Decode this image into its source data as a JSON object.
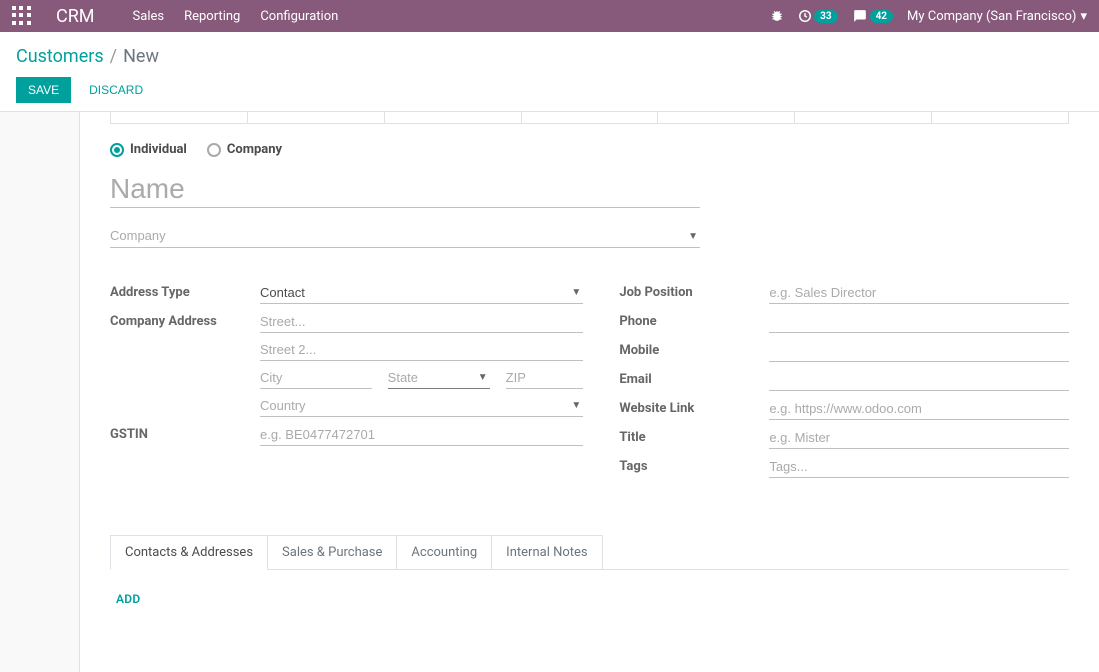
{
  "nav": {
    "brand": "CRM",
    "links": [
      "Sales",
      "Reporting",
      "Configuration"
    ],
    "badge1": "33",
    "badge2": "42",
    "company": "My Company (San Francisco)"
  },
  "breadcrumb": {
    "parent": "Customers",
    "current": "New"
  },
  "buttons": {
    "save": "Save",
    "discard": "Discard"
  },
  "radios": {
    "individual": "Individual",
    "company": "Company"
  },
  "name_placeholder": "Name",
  "company_placeholder": "Company",
  "left": {
    "address_type": {
      "label": "Address Type",
      "value": "Contact"
    },
    "company_address": {
      "label": "Company Address"
    },
    "street_ph": "Street...",
    "street2_ph": "Street 2...",
    "city_ph": "City",
    "state_ph": "State",
    "zip_ph": "ZIP",
    "country_ph": "Country",
    "gstin": {
      "label": "GSTIN",
      "placeholder": "e.g. BE0477472701"
    }
  },
  "right": {
    "job": {
      "label": "Job Position",
      "placeholder": "e.g. Sales Director"
    },
    "phone": {
      "label": "Phone"
    },
    "mobile": {
      "label": "Mobile"
    },
    "email": {
      "label": "Email"
    },
    "website": {
      "label": "Website Link",
      "placeholder": "e.g. https://www.odoo.com"
    },
    "title": {
      "label": "Title",
      "placeholder": "e.g. Mister"
    },
    "tags": {
      "label": "Tags",
      "placeholder": "Tags..."
    }
  },
  "tabs": {
    "contacts": "Contacts & Addresses",
    "sales": "Sales & Purchase",
    "accounting": "Accounting",
    "notes": "Internal Notes",
    "add": "Add"
  }
}
